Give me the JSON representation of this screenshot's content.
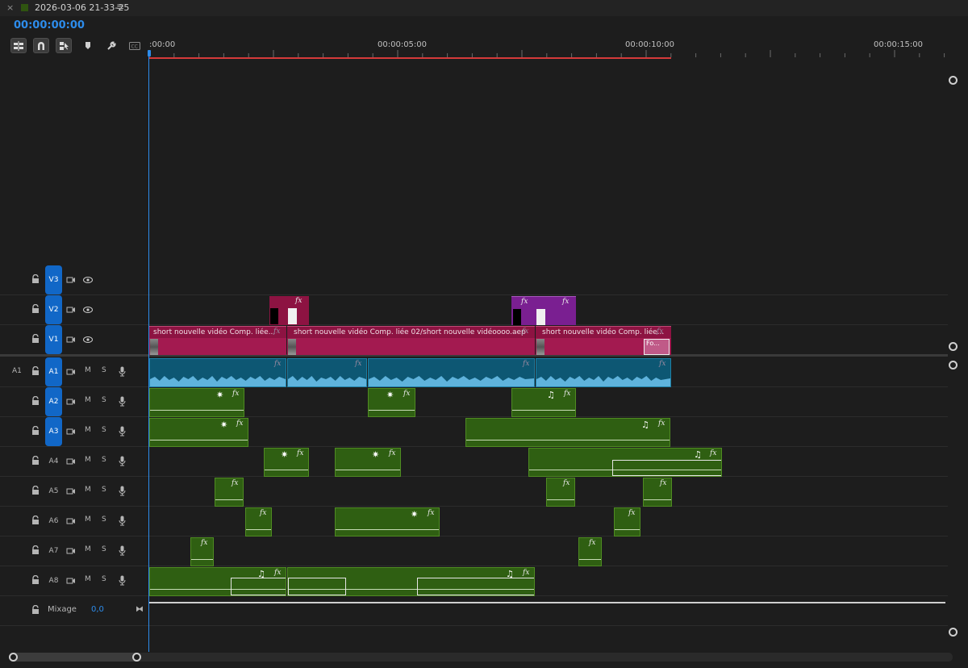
{
  "tab": {
    "close": "×",
    "sequence_name": "2026-03-06 21-33-25",
    "menu": "≡",
    "color": "#2f5410"
  },
  "timecode": "00:00:00:00",
  "toolbar": [
    "nest-icon",
    "snap-magnet-icon",
    "linked-selection-icon",
    "add-marker-icon",
    "settings-wrench-icon",
    "captions-icon"
  ],
  "ruler": {
    "labels": [
      ":00:00",
      "00:00:05:00",
      "00:00:10:00",
      "00:00:15:00"
    ]
  },
  "tracks": {
    "video": [
      {
        "name": "V3",
        "target": "V3"
      },
      {
        "name": "V2",
        "target": "V2"
      },
      {
        "name": "V1",
        "patch": "",
        "target": "V1"
      }
    ],
    "audio": [
      {
        "patch": "A1",
        "target": "A1",
        "m": "M",
        "s": "S"
      },
      {
        "target": "A2",
        "m": "M",
        "s": "S"
      },
      {
        "target": "A3",
        "m": "M",
        "s": "S"
      },
      {
        "target": "A4",
        "m": "M",
        "s": "S"
      },
      {
        "target": "A5",
        "m": "M",
        "s": "S"
      },
      {
        "target": "A6",
        "m": "M",
        "s": "S"
      },
      {
        "target": "A7",
        "m": "M",
        "s": "S"
      },
      {
        "target": "A8",
        "m": "M",
        "s": "S"
      }
    ],
    "mix": {
      "label": "Mixage",
      "value": "0,0",
      "end": "⧓"
    }
  },
  "clips": {
    "v1": [
      {
        "title": "short nouvelle vidéo Comp. liée...",
        "fx": "fx"
      },
      {
        "title": "short nouvelle vidéo Comp. liée 02/short nouvelle vidéoooo.aep",
        "fx": "fx"
      },
      {
        "title": "short nouvelle vidéo Comp. liée...",
        "fx": "fx",
        "tail": "Fo..."
      }
    ],
    "fx_label": "fx"
  },
  "colors": {
    "accent": "#2d8ceb",
    "video_clip": "#8d1342",
    "purple_clip": "#7a1f91",
    "a1_clip": "#0d5773",
    "audio_clip": "#2f5f12",
    "workarea": "#d53a3a"
  }
}
